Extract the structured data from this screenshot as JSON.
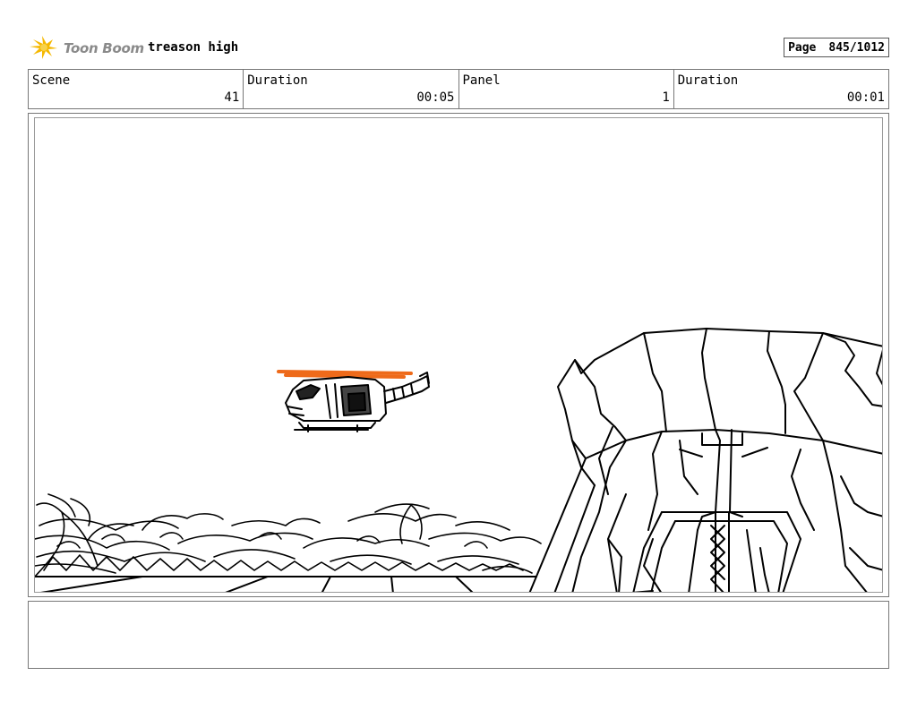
{
  "header": {
    "logo_text": "Toon Boom",
    "project_title": "treason high",
    "page_label": "Page",
    "page_value": "845/1012"
  },
  "info": {
    "scene_label": "Scene",
    "scene_value": "41",
    "scene_duration_label": "Duration",
    "scene_duration_value": "00:05",
    "panel_label": "Panel",
    "panel_value": "1",
    "panel_duration_label": "Duration",
    "panel_duration_value": "00:01"
  },
  "colors": {
    "logo_accent": "#f5b800",
    "rotor_orange": "#ee6a1a",
    "ink": "#000000"
  },
  "notes": {
    "text": ""
  }
}
